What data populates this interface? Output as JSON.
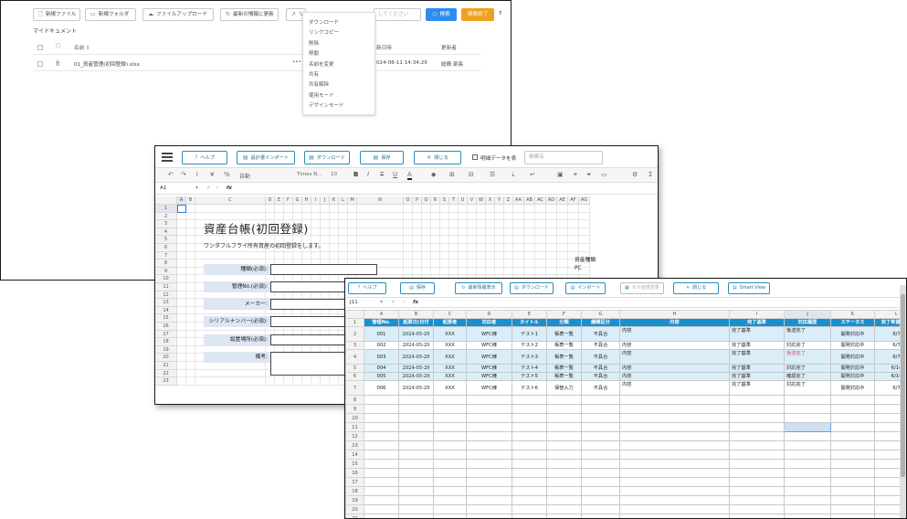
{
  "filemgr": {
    "toolbar": [
      {
        "icon": "new-file-icon",
        "glyph": "🗋",
        "label": "新規ファイル"
      },
      {
        "icon": "new-folder-icon",
        "glyph": "▭",
        "label": "新規フォルダ"
      },
      {
        "icon": "upload-icon",
        "glyph": "☁",
        "label": "ファイルアップロード"
      },
      {
        "icon": "refresh-icon",
        "glyph": "↻",
        "label": "最新の情報に更新"
      }
    ],
    "partial_btn": "リ",
    "search_placeholder": "してください",
    "search_btn": "検索",
    "finish_btn": "検索終了",
    "help": "?",
    "breadcrumb": "マイドキュメント",
    "col_name": "名前",
    "col_date": "新日時",
    "col_updater": "更新者",
    "file": {
      "name": "01_資産管理(初回登録).xlsx",
      "dots": "•••",
      "date": "024-06-11 14:34:29",
      "updater": "総務 部長"
    },
    "context_menu": [
      "ダウンロード",
      "リンクコピー",
      "削除",
      "移動",
      "名前を変更",
      "共有",
      "共有解除",
      "使用モード",
      "デザインモード"
    ]
  },
  "sheet1": {
    "buttons": [
      {
        "icon": "help-icon",
        "glyph": "?",
        "label": "ヘルプ"
      },
      {
        "icon": "import-icon",
        "glyph": "▤",
        "label": "設計書インポート"
      },
      {
        "icon": "download-icon",
        "glyph": "▤",
        "label": "ダウンロード"
      },
      {
        "icon": "save-icon",
        "glyph": "▤",
        "label": "保存"
      },
      {
        "icon": "close-icon",
        "glyph": "✕",
        "label": "閉じる"
      }
    ],
    "hide_data_label": "明細データを表",
    "form_name_placeholder": "帳票名",
    "font_label": "自動",
    "font_name": "Times N…",
    "font_size": "10",
    "cell_ref": "A1",
    "fx": "fx",
    "columns": [
      "A",
      "B",
      "C",
      "D",
      "E",
      "F",
      "G",
      "H",
      "I",
      "J",
      "K",
      "L",
      "M",
      "N",
      "O",
      "P",
      "Q",
      "R",
      "S",
      "T",
      "U",
      "V",
      "W",
      "X",
      "Y",
      "Z",
      "AA",
      "AB",
      "AC",
      "AD",
      "AE",
      "AF",
      "AG"
    ],
    "rows": [
      "1",
      "2",
      "3",
      "4",
      "5",
      "6",
      "7",
      "8",
      "9",
      "10",
      "11",
      "12",
      "13",
      "14",
      "15",
      "16",
      "17",
      "18",
      "19",
      "20",
      "21",
      "22",
      "23"
    ],
    "title": "資産台帳(初回登録)",
    "subtitle": "ワンダフルフライ所有資産の初回登録をします。",
    "fields": [
      "種類(必須):",
      "管理No.(必須):",
      "メーカー:",
      "シリアルナンバー(必須):",
      "設置場所(必須):",
      "備考:"
    ],
    "side_label": "資産種類",
    "side_value": "PC"
  },
  "sheet2": {
    "buttons": [
      {
        "icon": "help-icon",
        "glyph": "?",
        "label": "ヘルプ"
      },
      {
        "icon": "save-icon",
        "glyph": "▤",
        "label": "保存"
      },
      {
        "icon": "refresh-icon",
        "glyph": "↻",
        "label": "最新情報表示"
      },
      {
        "icon": "download-icon",
        "glyph": "▤",
        "label": "ダウンロード"
      },
      {
        "icon": "import-icon",
        "glyph": "▤",
        "label": "インポート"
      },
      {
        "icon": "cell-icon",
        "glyph": "▦",
        "label": "セル値選変更"
      },
      {
        "icon": "close-icon",
        "glyph": "✕",
        "label": "閉じる"
      },
      {
        "icon": "smartview-icon",
        "glyph": "▤",
        "label": "Smart View"
      }
    ],
    "cell_ref": "J11",
    "fx": "fx",
    "columns": [
      "A",
      "B",
      "C",
      "D",
      "E",
      "F",
      "G",
      "H",
      "I",
      "J",
      "K",
      "L"
    ],
    "header": [
      "管理No.",
      "起票日(日付",
      "起票者",
      "対応者",
      "タイトル",
      "分類",
      "課題区分",
      "内容",
      "完了基準",
      "対応履歴",
      "ステータス",
      "完了希望日(日"
    ],
    "rows": [
      [
        "001",
        "2024-05-29",
        "XXX",
        "WFC様",
        "テスト1",
        "帳表一覧",
        "不具合",
        "内容",
        "完了基準",
        "後送完了",
        "開発対応中",
        "6/7"
      ],
      [
        "002",
        "2024-05-29",
        "XXX",
        "WFC様",
        "テスト2",
        "帳表一覧",
        "不具合",
        "内容",
        "完了基準",
        "対応完了",
        "開発対応中",
        "6/7"
      ],
      [
        "003",
        "2024-05-29",
        "XXX",
        "WFC様",
        "テスト3",
        "帳表一覧",
        "不具合",
        "内容",
        "完了基準",
        "後送完了",
        "開発対応中",
        "6/7"
      ],
      [
        "004",
        "2024-05-29",
        "XXX",
        "WFC様",
        "テスト4",
        "帳表一覧",
        "不具合",
        "内容",
        "完了基準",
        "対応完了",
        "開発対応中",
        "6/14"
      ],
      [
        "005",
        "2024-05-29",
        "XXX",
        "WFC様",
        "テスト5",
        "帳表一覧",
        "不具合",
        "内容",
        "完了基準",
        "確認完了",
        "開発対応中",
        "6/14"
      ],
      [
        "006",
        "2024-05-29",
        "XXX",
        "WFC様",
        "テスト6",
        "保管入力",
        "不具合",
        "内容",
        "完了基準",
        "対応完了",
        "開発対応中",
        "6/7"
      ]
    ],
    "row_nums": [
      "1",
      "2",
      "3",
      "4",
      "5",
      "6",
      "7",
      "8",
      "9",
      "10",
      "11",
      "12",
      "13",
      "14",
      "15",
      "16",
      "17",
      "18",
      "19",
      "20",
      "21",
      "22"
    ]
  }
}
